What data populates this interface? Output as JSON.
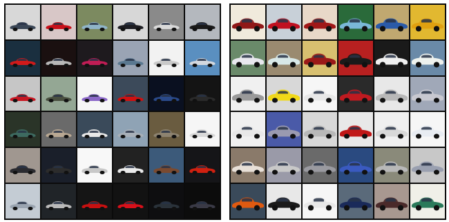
{
  "panels": [
    {
      "name": "left-sample-grid",
      "tiles": [
        {
          "bg": "#d8d8d8",
          "car": "#3a4656"
        },
        {
          "bg": "#d8c7c7",
          "car": "#c8101a"
        },
        {
          "bg": "#7c8a60",
          "car": "#8fb4c8"
        },
        {
          "bg": "#d7d7d7",
          "car": "#1d1d22"
        },
        {
          "bg": "#8a8a8a",
          "car": "#d9d9d9"
        },
        {
          "bg": "#b4b8be",
          "car": "#1a1a1a"
        },
        {
          "bg": "#1a2f3f",
          "car": "#d11a1a"
        },
        {
          "bg": "#1a1010",
          "car": "#b8b8b8"
        },
        {
          "bg": "#1e1a1e",
          "car": "#c01d55"
        },
        {
          "bg": "#9aa4b4",
          "car": "#5a7890"
        },
        {
          "bg": "#f2f2f2",
          "car": "#c9c9c9"
        },
        {
          "bg": "#5a8fc0",
          "car": "#d3d8de"
        },
        {
          "bg": "#c6c6c6",
          "car": "#c81622"
        },
        {
          "bg": "#94a794",
          "car": "#4a5040"
        },
        {
          "bg": "#f6f6f6",
          "car": "#8b68c8"
        },
        {
          "bg": "#3c4a5a",
          "car": "#d11010"
        },
        {
          "bg": "#0a1020",
          "car": "#2a4a8a"
        },
        {
          "bg": "#141414",
          "car": "#2a2a2a"
        },
        {
          "bg": "#2a3428",
          "car": "#3d6a60"
        },
        {
          "bg": "#6a6a6a",
          "car": "#b9a893"
        },
        {
          "bg": "#3a4a5a",
          "car": "#e8e8e8"
        },
        {
          "bg": "#8fa3b5",
          "car": "#a8b0b8"
        },
        {
          "bg": "#6a5c40",
          "car": "#8d8370"
        },
        {
          "bg": "#f6f6f6",
          "car": "#d9d9d9"
        },
        {
          "bg": "#a09790",
          "car": "#2b2b30"
        },
        {
          "bg": "#1a1f2a",
          "car": "#2c2c2c"
        },
        {
          "bg": "#f8f8f8",
          "car": "#c8c8c8"
        },
        {
          "bg": "#222222",
          "car": "#eaeaea"
        },
        {
          "bg": "#3c5a7a",
          "car": "#7a4a30"
        },
        {
          "bg": "#151518",
          "car": "#d02010"
        },
        {
          "bg": "#c4ccd4",
          "car": "#9aa4b0"
        },
        {
          "bg": "#202428",
          "car": "#b9b9b9"
        },
        {
          "bg": "#151515",
          "car": "#c81010"
        },
        {
          "bg": "#121212",
          "car": "#d8101a"
        },
        {
          "bg": "#0e0e10",
          "car": "#2a323a"
        },
        {
          "bg": "#0c0c0c",
          "car": "#3a3a46"
        }
      ]
    },
    {
      "name": "right-sample-grid",
      "tiles": [
        {
          "bg": "#f0eadc",
          "car": "#901818"
        },
        {
          "bg": "#c8d0d8",
          "car": "#c01020"
        },
        {
          "bg": "#e8d8c8",
          "car": "#a01818"
        },
        {
          "bg": "#2a6a3a",
          "car": "#7ab8d8"
        },
        {
          "bg": "#c0a870",
          "car": "#2a5aa8"
        },
        {
          "bg": "#e2b830",
          "car": "#e0a010"
        },
        {
          "bg": "#6a8a6a",
          "car": "#e8e8ee"
        },
        {
          "bg": "#9a8a70",
          "car": "#d8e8e8"
        },
        {
          "bg": "#d8c070",
          "car": "#9a1818"
        },
        {
          "bg": "#b82020",
          "car": "#1a1a1a"
        },
        {
          "bg": "#1a1a1a",
          "car": "#efefef"
        },
        {
          "bg": "#6a8aa8",
          "car": "#eef2ee"
        },
        {
          "bg": "#f0f0f0",
          "car": "#9a9a9a"
        },
        {
          "bg": "#d8d8d8",
          "car": "#f0d818"
        },
        {
          "bg": "#f6f6f6",
          "car": "#e8e8e8"
        },
        {
          "bg": "#2a2a2a",
          "car": "#c01a20"
        },
        {
          "bg": "#e8e8e8",
          "car": "#b8b8b8"
        },
        {
          "bg": "#a0a8b8",
          "car": "#c8c8d0"
        },
        {
          "bg": "#f0f0f0",
          "car": "#e8e8e8"
        },
        {
          "bg": "#4a5aa8",
          "car": "#9a9ab0"
        },
        {
          "bg": "#d8d8d8",
          "car": "#b8b8b8"
        },
        {
          "bg": "#e8e8e8",
          "car": "#c01818"
        },
        {
          "bg": "#f0f0f0",
          "car": "#d8d8d8"
        },
        {
          "bg": "#f6f6f6",
          "car": "#e8ecf2"
        },
        {
          "bg": "#8a7a6a",
          "car": "#e8e0d8"
        },
        {
          "bg": "#9a9aa8",
          "car": "#c8c8c8"
        },
        {
          "bg": "#6a6a6a",
          "car": "#9a9aa0"
        },
        {
          "bg": "#2a4a80",
          "car": "#3a5ac0"
        },
        {
          "bg": "#8a8a7a",
          "car": "#b8b8b8"
        },
        {
          "bg": "#c8c8c8",
          "car": "#9aa0b0"
        },
        {
          "bg": "#3a4a5a",
          "car": "#e05a10"
        },
        {
          "bg": "#e8e8e8",
          "car": "#1a1a1a"
        },
        {
          "bg": "#f6f6f6",
          "car": "#e8e8e8"
        },
        {
          "bg": "#5a6a7a",
          "car": "#1a2a5a"
        },
        {
          "bg": "#a89890",
          "car": "#4a2a2a"
        },
        {
          "bg": "#f0f0e8",
          "car": "#2a7a5a"
        }
      ]
    }
  ]
}
